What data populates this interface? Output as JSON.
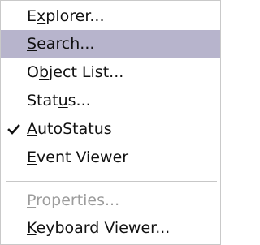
{
  "menu": {
    "items": [
      {
        "pre": "E",
        "key": "x",
        "post": "plorer..."
      },
      {
        "pre": "",
        "key": "S",
        "post": "earch..."
      },
      {
        "pre": "O",
        "key": "b",
        "post": "ject List..."
      },
      {
        "pre": "Stat",
        "key": "u",
        "post": "s..."
      },
      {
        "pre": "",
        "key": "A",
        "post": "utoStatus"
      },
      {
        "pre": "",
        "key": "E",
        "post": "vent Viewer"
      },
      {
        "pre": "",
        "key": "P",
        "post": "roperties..."
      },
      {
        "pre": "",
        "key": "K",
        "post": "eyboard Viewer..."
      }
    ],
    "highlighted_item": "Search...",
    "checked_item": "AutoStatus",
    "disabled_item": "Properties...",
    "highlight_color": "#b7b4cc",
    "disabled_text_color": "#9c9c9c",
    "check_icon": "checkmark-icon"
  }
}
